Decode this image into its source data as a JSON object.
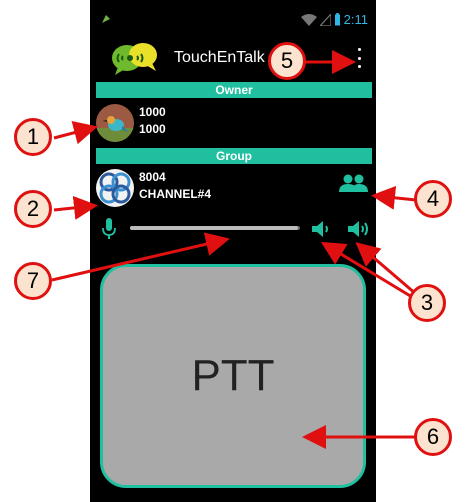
{
  "status_bar": {
    "time": "2:11",
    "icons": [
      "app-notification-icon",
      "wifi-icon",
      "signal-icon",
      "battery-icon"
    ]
  },
  "action_bar": {
    "title": "TouchEnTalk",
    "logo_icon": "chat-bubbles-logo-icon",
    "menu_icon": "overflow-menu-icon"
  },
  "owner": {
    "header": "Owner",
    "line1": "1000",
    "line2": "1000",
    "avatar_icon": "bird-avatar-icon"
  },
  "group": {
    "header": "Group",
    "line1": "8004",
    "line2": "CHANNEL#4",
    "avatar_icon": "celtic-knot-avatar-icon",
    "members_icon": "group-members-icon"
  },
  "volume": {
    "mic_icon": "microphone-icon",
    "level": 0.99,
    "speaker_low_icon": "speaker-low-icon",
    "speaker_high_icon": "speaker-high-icon"
  },
  "ptt": {
    "label": "PTT"
  },
  "callouts": [
    "1",
    "2",
    "3",
    "4",
    "5",
    "6",
    "7"
  ],
  "colors": {
    "accent": "#1fbf9f",
    "callout_border": "#e01010",
    "callout_fill": "#fbe3cf",
    "ptt_fill": "#a9a9a9",
    "status_blue": "#33b5e5"
  }
}
